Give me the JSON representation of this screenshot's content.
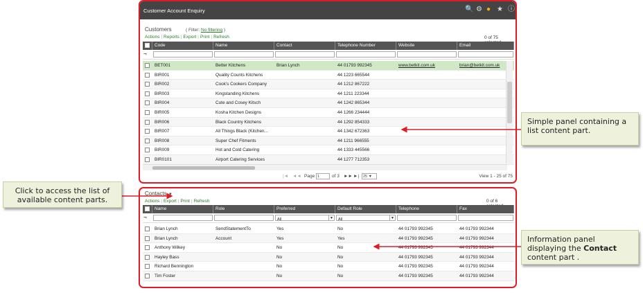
{
  "window": {
    "title": "Customer Account Enquiry"
  },
  "icons": [
    "binoculars-icon",
    "gear-icon",
    "lightbulb-icon",
    "star-icon",
    "help-icon"
  ],
  "customers": {
    "title": "Customers",
    "filter_prefix": "( Filter: ",
    "filter_link": "No filtering",
    "filter_suffix": " )",
    "actions": [
      "Actions",
      "Reports",
      "Export",
      "Print",
      "Refresh"
    ],
    "selected": "0 of 75 selected",
    "columns": [
      "Code",
      "Name",
      "Contact",
      "Telephone Number",
      "Website",
      "Email"
    ],
    "rows": [
      [
        "BET001",
        "Better Kitchens",
        "Brian Lynch",
        "44 01793 992345",
        "www.betkit.com.uk",
        "brian@betkit.com.uk"
      ],
      [
        "BIR001",
        "Quality Counts Kitchens",
        "",
        "44 1223 665544",
        "",
        ""
      ],
      [
        "BIR002",
        "Cook's Cookers Company",
        "",
        "44 1212 867222",
        "",
        ""
      ],
      [
        "BIR003",
        "Kingstanding Kitchens",
        "",
        "44 1211 223344",
        "",
        ""
      ],
      [
        "BIR004",
        "Cute and Cosey Kitsch",
        "",
        "44 1242 865344",
        "",
        ""
      ],
      [
        "BIR005",
        "Kosha Kitchen Designs",
        "",
        "44 1266 234444",
        "",
        ""
      ],
      [
        "BIR006",
        "Black Country Kitchens",
        "",
        "44 1292 854333",
        "",
        ""
      ],
      [
        "BIR007",
        "All Things Black (Kitchen...",
        "",
        "44 1342 672363",
        "",
        ""
      ],
      [
        "BIR008",
        "Super Chef Fitments",
        "",
        "44 1211 966555",
        "",
        ""
      ],
      [
        "BIR009",
        "Hot and Cold Catering",
        "",
        "44 1333 445566",
        "",
        ""
      ],
      [
        "BIR0101",
        "Airport Catering Services",
        "",
        "44 1277 712353",
        "",
        ""
      ]
    ],
    "pager": {
      "page_label": "Page",
      "page_value": "1",
      "of_label": "of 3",
      "page_size": "25",
      "view": "View 1 - 25 of 75"
    }
  },
  "contacts": {
    "title": "Contacts",
    "actions": [
      "Actions",
      "Export",
      "Print",
      "Refresh"
    ],
    "selected": "0 of 6 selected",
    "columns": [
      "Name",
      "Role",
      "Preferred",
      "Default Role",
      "Telephone",
      "Fax"
    ],
    "filter_all": "All",
    "rows": [
      [
        "Brian Lynch",
        "SendStatementTo",
        "Yes",
        "No",
        "44 01793 992345",
        "44 01793 992344"
      ],
      [
        "Brian Lynch",
        "Account",
        "Yes",
        "Yes",
        "44 01793 992345",
        "44 01793 992344"
      ],
      [
        "Anthony Wilkey",
        "",
        "No",
        "No",
        "44 01793 992345",
        "44 01793 992344"
      ],
      [
        "Hayley Bass",
        "",
        "No",
        "No",
        "44 01793 992345",
        "44 01793 992344"
      ],
      [
        "Richard Bennington",
        "",
        "No",
        "No",
        "44 01793 992345",
        "44 01793 992344"
      ],
      [
        "Tim Foster",
        "",
        "No",
        "No",
        "44 01793 992345",
        "44 01793 992344"
      ]
    ]
  },
  "callouts": {
    "simple": "Simple panel containing a list content part.",
    "click": "Click to access the list of available content parts.",
    "info_pre": "Information panel displaying the ",
    "info_bold": "Contact",
    "info_post": " content part ."
  },
  "colors": {
    "frame": "#e01b24",
    "titlebar": "#444444",
    "selected_row": "#cfe9c6",
    "link": "#2b7a2b",
    "callout_bg": "#eef1dc"
  }
}
